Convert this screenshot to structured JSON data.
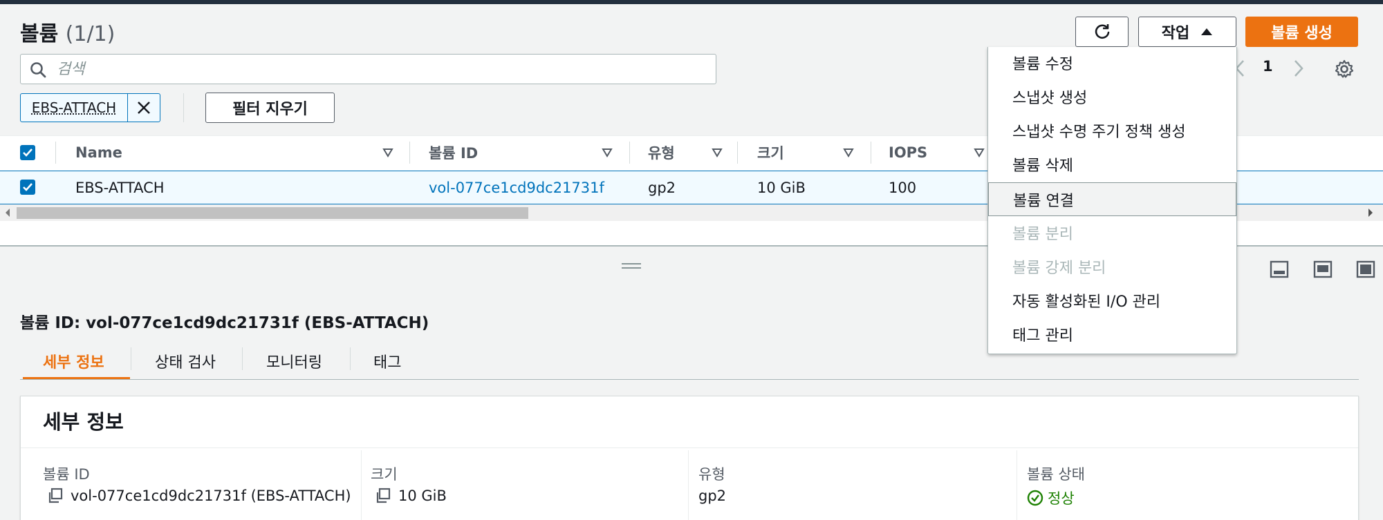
{
  "header": {
    "title": "볼륨",
    "count": "(1/1)",
    "actions_label": "작업",
    "create_label": "볼륨 생성"
  },
  "search": {
    "placeholder": "검색"
  },
  "filter": {
    "token": "EBS-ATTACH",
    "clear_label": "필터 지우기"
  },
  "pagination": {
    "page": "1"
  },
  "table": {
    "columns": [
      "Name",
      "볼륨 ID",
      "유형",
      "크기",
      "IOPS"
    ],
    "rows": [
      {
        "name": "EBS-ATTACH",
        "volume_id": "vol-077ce1cd9dc21731f",
        "type": "gp2",
        "size": "10 GiB",
        "iops": "100",
        "selected": true
      }
    ]
  },
  "actions_menu": {
    "items": [
      {
        "label": "볼륨 수정",
        "disabled": false
      },
      {
        "label": "스냅샷 생성",
        "disabled": false
      },
      {
        "label": "스냅샷 수명 주기 정책 생성",
        "disabled": false
      },
      {
        "label": "볼륨 삭제",
        "disabled": false
      },
      {
        "label": "볼륨 연결",
        "disabled": false,
        "highlighted": true
      },
      {
        "label": "볼륨 분리",
        "disabled": true
      },
      {
        "label": "볼륨 강제 분리",
        "disabled": true
      },
      {
        "label": "자동 활성화된 I/O 관리",
        "disabled": false
      },
      {
        "label": "태그 관리",
        "disabled": false
      }
    ]
  },
  "detail": {
    "heading": "볼륨 ID: vol-077ce1cd9dc21731f (EBS-ATTACH)",
    "tabs": [
      "세부 정보",
      "상태 검사",
      "모니터링",
      "태그"
    ],
    "active_tab": "세부 정보",
    "panel_title": "세부 정보",
    "fields": [
      {
        "label": "볼륨 ID",
        "value": "vol-077ce1cd9dc21731f (EBS-ATTACH)"
      },
      {
        "label": "크기",
        "value": "10 GiB"
      },
      {
        "label": "유형",
        "value": "gp2"
      },
      {
        "label": "볼륨 상태",
        "value": "정상"
      }
    ]
  },
  "colors": {
    "primary": "#ec7211",
    "link": "#0073bb",
    "success": "#1d8102",
    "topbar": "#232f3e"
  }
}
